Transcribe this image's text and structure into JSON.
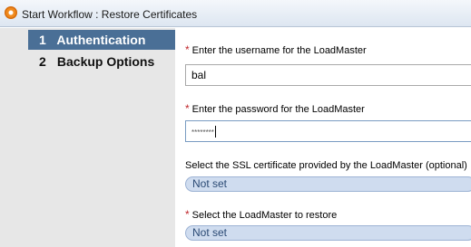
{
  "window": {
    "title": "Start Workflow : Restore Certificates",
    "icon": "workflow-icon"
  },
  "steps": [
    {
      "number": "1",
      "label": "Authentication",
      "active": true
    },
    {
      "number": "2",
      "label": "Backup Options",
      "active": false
    }
  ],
  "form": {
    "username": {
      "label": "Enter the username for the LoadMaster",
      "value": "bal",
      "required": true
    },
    "password": {
      "label": "Enter the password for the LoadMaster",
      "value": "********",
      "required": true
    },
    "certificate": {
      "label": "Select the SSL certificate provided by the LoadMaster (optional)",
      "value": "Not set",
      "required": false
    },
    "loadmaster": {
      "label": "Select the LoadMaster to restore",
      "value": "Not set",
      "required": true
    }
  },
  "colors": {
    "active_step": "#4a6f96",
    "sidebar": "#e7e7e7",
    "required_mark": "#c0262b",
    "select_fill": "#cfdcef"
  }
}
